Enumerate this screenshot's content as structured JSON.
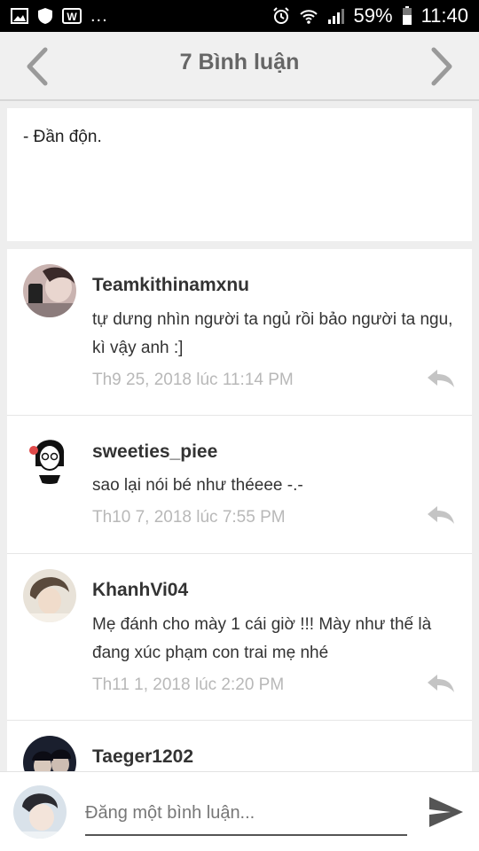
{
  "status_bar": {
    "dots": "...",
    "battery": "59%",
    "time": "11:40"
  },
  "header": {
    "title": "7 Bình luận",
    "prev_icon": "chevron-left-icon",
    "next_icon": "chevron-right-icon"
  },
  "post": {
    "text": "- Đần độn."
  },
  "comments": [
    {
      "username": "Teamkithinamxnu",
      "text": "tự dưng nhìn người ta ngủ rồi bảo người ta ngu, kì vậy anh :]",
      "time": "Th9 25, 2018 lúc 11:14 PM"
    },
    {
      "username": "sweeties_piee",
      "text": "sao lại nói bé như théeee -.-",
      "time": "Th10 7, 2018 lúc 7:55 PM"
    },
    {
      "username": "KhanhVi04",
      "text": "Mẹ đánh cho mày 1 cái giờ !!! Mày như thế là đang xúc phạm con trai mẹ nhé",
      "time": "Th11 1, 2018 lúc 2:20 PM"
    },
    {
      "username": "Taeger1202"
    }
  ],
  "composer": {
    "placeholder": "Đăng một bình luận...",
    "send_icon": "send-icon"
  },
  "colors": {
    "header_bg": "#f0f0f0",
    "title": "#666666",
    "timestamp": "#b8b8b8",
    "reply_icon": "#c4c4c4"
  }
}
